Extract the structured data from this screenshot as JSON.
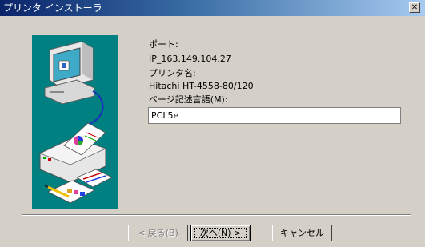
{
  "window": {
    "title": "プリンタ インストーラ"
  },
  "icons": {
    "close": "close-icon",
    "illustration": "computer-printer-illustration"
  },
  "fields": {
    "port_label": "ポート:",
    "port_value": "IP_163.149.104.27",
    "printer_name_label": "プリンタ名:",
    "printer_name_value": "Hitachi HT-4558-80/120",
    "pdl_label": "ページ記述言語(M):",
    "pdl_value": "PCL5e"
  },
  "buttons": {
    "back": "< 戻る(B)",
    "next": "次へ(N) >",
    "cancel": "キャンセル"
  },
  "colors": {
    "title_start": "#0a246a",
    "title_end": "#a6caf0",
    "dialog_bg": "#d4d0c8",
    "illustration_bg": "#008080"
  }
}
